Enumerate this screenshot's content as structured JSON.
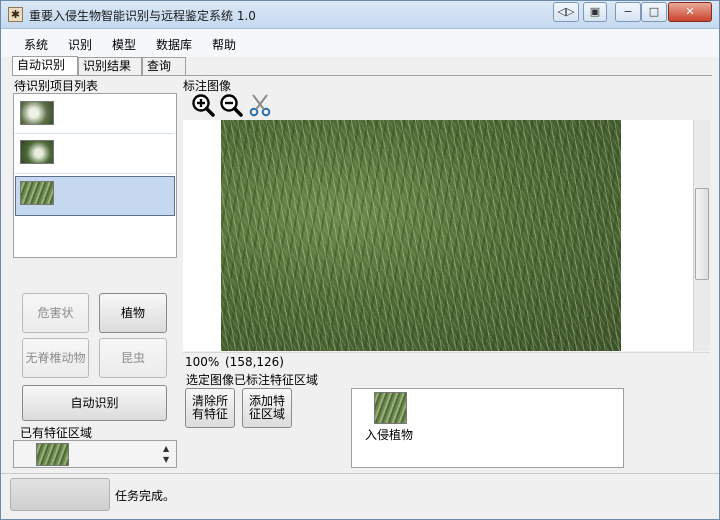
{
  "window": {
    "title": "重要入侵生物智能识别与远程鉴定系统 1.0",
    "close_glyph": "✕",
    "minimize_glyph": "−",
    "maximize_glyph": "□"
  },
  "menu": [
    "系统",
    "识别",
    "模型",
    "数据库",
    "帮助"
  ],
  "tabs": [
    "自动识别",
    "识别结果",
    "查询"
  ],
  "left": {
    "list_title": "待识别项目列表",
    "buttons": {
      "harm": "危害状",
      "plant": "植物",
      "invertebrate": "无脊椎动物",
      "insect": "昆虫",
      "auto_identify": "自动识别"
    },
    "feature_area_label": "已有特征区域"
  },
  "right": {
    "annot_label": "标注图像",
    "zoom_text": "100%",
    "coord_text": "(158,126)",
    "selected_label": "选定图像已标注特征区域",
    "clear_button": "清除所有特征",
    "add_button": "添加特征区域",
    "feature_caption": "入侵植物"
  },
  "status": {
    "message": "任务完成。"
  },
  "icons": [
    "zoom-in-icon",
    "zoom-out-icon",
    "scissors-icon"
  ]
}
